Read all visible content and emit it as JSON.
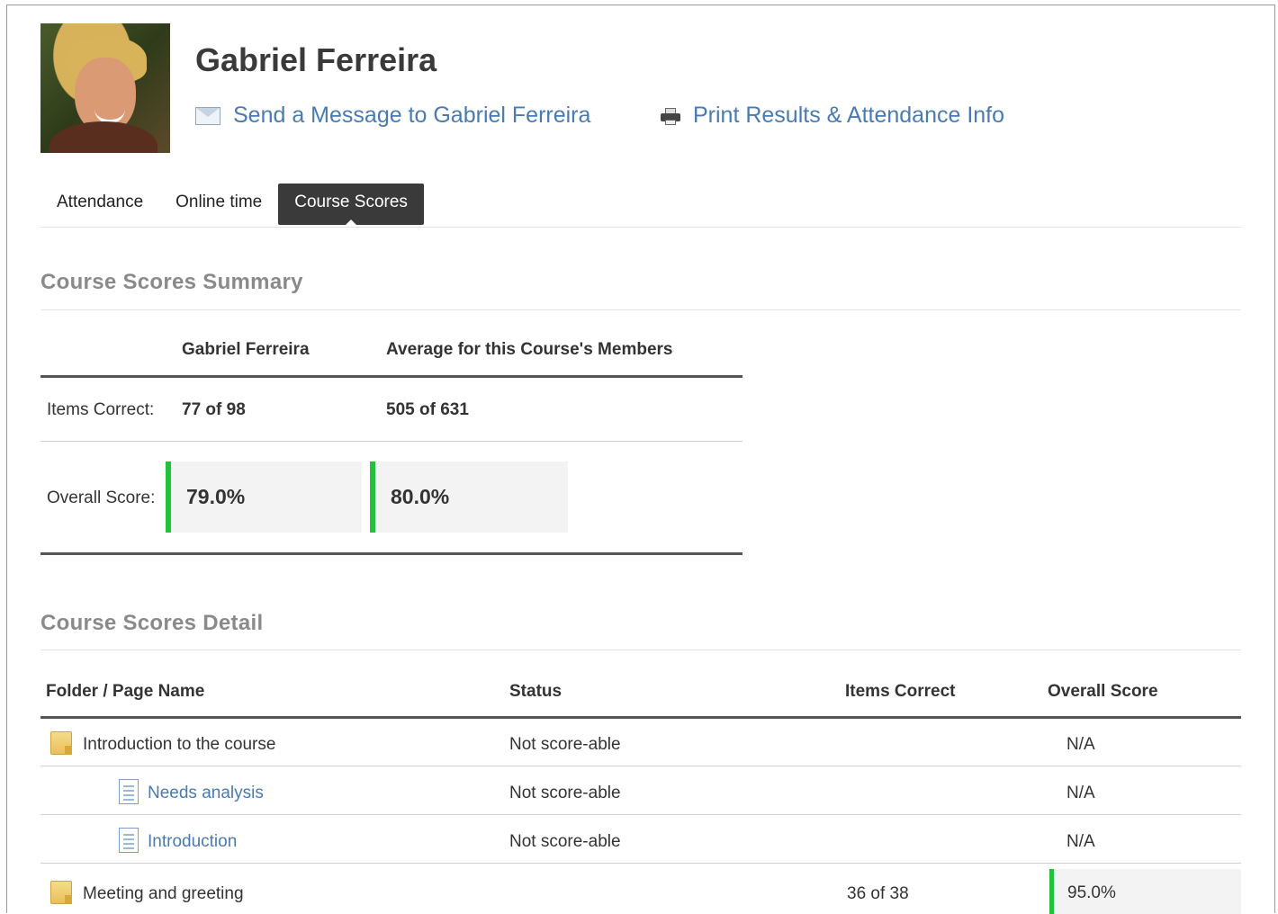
{
  "profile": {
    "name": "Gabriel Ferreira",
    "send_message": "Send a Message to Gabriel Ferreira",
    "print_results": "Print Results & Attendance Info"
  },
  "tabs": [
    {
      "label": "Attendance",
      "active": false
    },
    {
      "label": "Online time",
      "active": false
    },
    {
      "label": "Course Scores",
      "active": true
    }
  ],
  "summary": {
    "title": "Course Scores Summary",
    "col_student": "Gabriel Ferreira",
    "col_average": "Average for this Course's Members",
    "items_correct_label": "Items Correct:",
    "items_correct_student": "77 of 98",
    "items_correct_average": "505 of 631",
    "overall_score_label": "Overall Score:",
    "overall_score_student": "79.0%",
    "overall_score_average": "80.0%",
    "accent_color": "#22c33a"
  },
  "detail": {
    "title": "Course Scores Detail",
    "headers": {
      "name": "Folder / Page Name",
      "status": "Status",
      "items_correct": "Items Correct",
      "overall_score": "Overall Score"
    },
    "rows": [
      {
        "type": "folder",
        "name": "Introduction to the course",
        "status": "Not score-able",
        "items_correct": "",
        "overall_score": "N/A"
      },
      {
        "type": "page",
        "name": "Needs analysis",
        "status": "Not score-able",
        "items_correct": "",
        "overall_score": "N/A"
      },
      {
        "type": "page",
        "name": "Introduction",
        "status": "Not score-able",
        "items_correct": "",
        "overall_score": "N/A"
      },
      {
        "type": "folder",
        "name": "Meeting and greeting",
        "status": "",
        "items_correct": "36 of 38",
        "overall_score": "95.0%"
      }
    ]
  },
  "icons": {
    "message": "envelope-icon",
    "print": "printer-icon",
    "folder": "folder-icon",
    "page": "page-icon"
  }
}
